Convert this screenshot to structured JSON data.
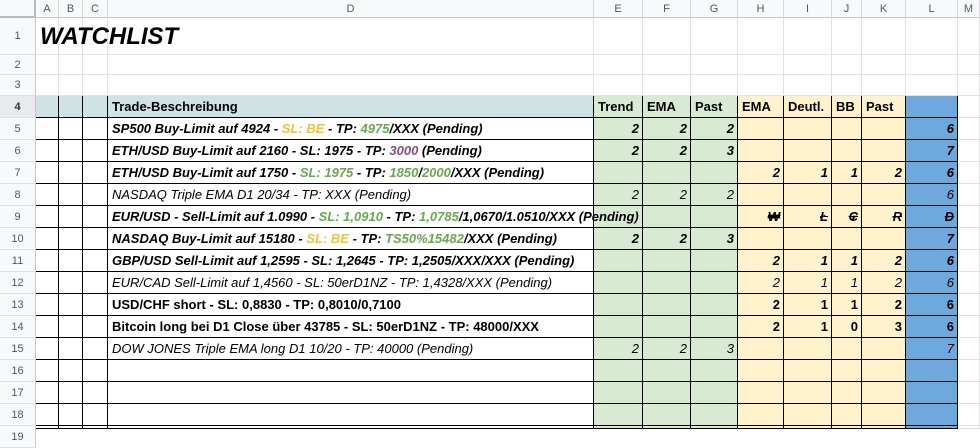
{
  "columns": [
    "A",
    "B",
    "C",
    "D",
    "E",
    "F",
    "G",
    "H",
    "I",
    "J",
    "K",
    "L",
    "M"
  ],
  "rows": [
    "1",
    "2",
    "3",
    "4",
    "5",
    "6",
    "7",
    "8",
    "9",
    "10",
    "11",
    "12",
    "13",
    "14",
    "15",
    "16",
    "17",
    "18",
    "19"
  ],
  "selected_row": "4",
  "title": "WATCHLIST",
  "headers": {
    "desc": "Trade-Beschreibung",
    "trend": "Trend",
    "ema1": "EMA",
    "past1": "Past",
    "ema2": "EMA",
    "deutl": "Deutl.",
    "bb": "BB",
    "past2": "Past"
  },
  "colors": {
    "green": "#6aa84f",
    "orange": "#f1c232",
    "purple": "#8e4b7a",
    "green_fill": "#d9ead3",
    "yellow_fill": "#fff2cc",
    "blue_fill": "#6fa8dc"
  },
  "trades": [
    {
      "style": "bi",
      "segs": [
        {
          "t": "SP500 Buy-Limit auf 4924 - "
        },
        {
          "t": "SL: BE",
          "c": "orange"
        },
        {
          "t": " - TP: "
        },
        {
          "t": "4975",
          "c": "green"
        },
        {
          "t": "/XXX (Pending)"
        }
      ],
      "e": "2",
      "f": "2",
      "g": "2",
      "h": "",
      "i": "",
      "j": "",
      "k": "",
      "l": "6"
    },
    {
      "style": "bi",
      "segs": [
        {
          "t": "ETH/USD Buy-Limit auf 2160 - SL: 1975 - TP: "
        },
        {
          "t": "3000",
          "c": "purple"
        },
        {
          "t": " (Pending)"
        }
      ],
      "e": "2",
      "f": "2",
      "g": "3",
      "h": "",
      "i": "",
      "j": "",
      "k": "",
      "l": "7"
    },
    {
      "style": "bi",
      "segs": [
        {
          "t": "ETH/USD Buy-Limit auf 1750 - "
        },
        {
          "t": "SL: 1975",
          "c": "green"
        },
        {
          "t": " - TP: "
        },
        {
          "t": "1850",
          "c": "green"
        },
        {
          "t": "/"
        },
        {
          "t": "2000",
          "c": "green"
        },
        {
          "t": "/XXX (Pending)"
        }
      ],
      "e": "",
      "f": "",
      "g": "",
      "h": "2",
      "i": "1",
      "j": "1",
      "k": "2",
      "l": "6"
    },
    {
      "style": "it",
      "segs": [
        {
          "t": "NASDAQ Triple EMA D1 20/34 - TP: XXX (Pending)"
        }
      ],
      "e": "2",
      "f": "2",
      "g": "2",
      "h": "",
      "i": "",
      "j": "",
      "k": "",
      "l": "6"
    },
    {
      "style": "bi",
      "segs": [
        {
          "t": "EUR/USD - Sell-Limit auf 1.0990 - "
        },
        {
          "t": "SL: 1,0910",
          "c": "green"
        },
        {
          "t": " - TP: "
        },
        {
          "t": "1,0785",
          "c": "green"
        },
        {
          "t": "/1,0670/1.0510/XXX (Pending)"
        }
      ],
      "e": "",
      "f": "",
      "g": "",
      "h": "₩",
      "i": "Ł",
      "j": "₢",
      "k": "Ɍ",
      "l": "Đ",
      "symbols": true
    },
    {
      "style": "bi",
      "segs": [
        {
          "t": "NASDAQ Buy-Limit auf 15180 - "
        },
        {
          "t": "SL: BE",
          "c": "orange"
        },
        {
          "t": " - TP: "
        },
        {
          "t": "TS50%15482",
          "c": "green"
        },
        {
          "t": "/XXX (Pending)"
        }
      ],
      "e": "2",
      "f": "2",
      "g": "3",
      "h": "",
      "i": "",
      "j": "",
      "k": "",
      "l": "7"
    },
    {
      "style": "bi",
      "segs": [
        {
          "t": "GBP/USD Sell-Limit auf 1,2595 - SL: 1,2645 - TP: 1,2505/XXX/XXX (Pending)"
        }
      ],
      "e": "",
      "f": "",
      "g": "",
      "h": "2",
      "i": "1",
      "j": "1",
      "k": "2",
      "l": "6"
    },
    {
      "style": "it",
      "segs": [
        {
          "t": "EUR/CAD Sell-Limit auf 1,4560 - SL: 50erD1NZ - TP: 1,4328/XXX (Pending)"
        }
      ],
      "e": "",
      "f": "",
      "g": "",
      "h": "2",
      "i": "1",
      "j": "1",
      "k": "2",
      "l": "6"
    },
    {
      "style": "bo",
      "segs": [
        {
          "t": "USD/CHF short - SL: 0,8830 - TP: 0,8010/0,7100"
        }
      ],
      "e": "",
      "f": "",
      "g": "",
      "h": "2",
      "i": "1",
      "j": "1",
      "k": "2",
      "l": "6"
    },
    {
      "style": "bo",
      "segs": [
        {
          "t": "Bitcoin long bei D1 Close über 43785 - SL: 50erD1NZ - TP: 48000/XXX"
        }
      ],
      "e": "",
      "f": "",
      "g": "",
      "h": "2",
      "i": "1",
      "j": "0",
      "k": "3",
      "l": "6"
    },
    {
      "style": "it",
      "segs": [
        {
          "t": "DOW JONES Triple EMA long D1 10/20 - TP: 40000 (Pending)"
        }
      ],
      "e": "2",
      "f": "2",
      "g": "3",
      "h": "",
      "i": "",
      "j": "",
      "k": "",
      "l": "7"
    }
  ]
}
